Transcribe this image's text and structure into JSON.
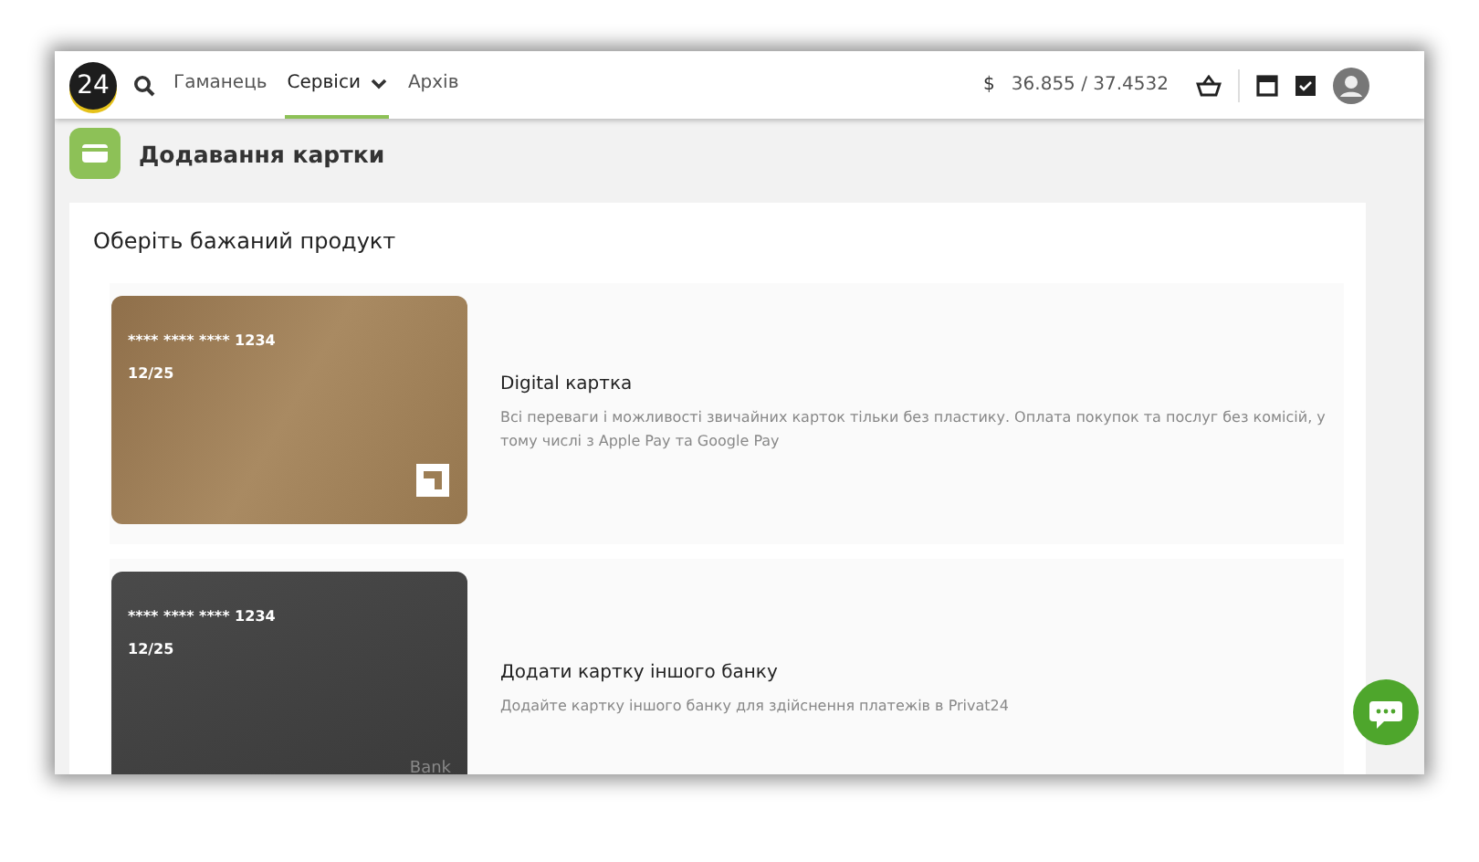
{
  "header": {
    "logo": "24",
    "nav": [
      {
        "label": "Гаманець",
        "selected": false,
        "dropdown": false
      },
      {
        "label": "Сервіси",
        "selected": true,
        "dropdown": true
      },
      {
        "label": "Архів",
        "selected": false,
        "dropdown": false
      }
    ],
    "currency": "$",
    "rate": "36.855 / 37.4532"
  },
  "page_title": "Додавання картки",
  "section_title": "Оберіть бажаний продукт",
  "products": [
    {
      "kind": "gold",
      "number": "**** **** **** 1234",
      "expiry": "12/25",
      "title": "Digital картка",
      "description": "Всі переваги і можливості звичайних карток тільки без пластику. Оплата покупок та послуг без комісій, у тому числі з Apple Pay та Google Pay"
    },
    {
      "kind": "dark",
      "number": "**** **** **** 1234",
      "expiry": "12/25",
      "brand": "Bank",
      "title": "Додати картку іншого банку",
      "description": "Додайте картку іншого банку для здійснення платежів в Privat24"
    }
  ]
}
